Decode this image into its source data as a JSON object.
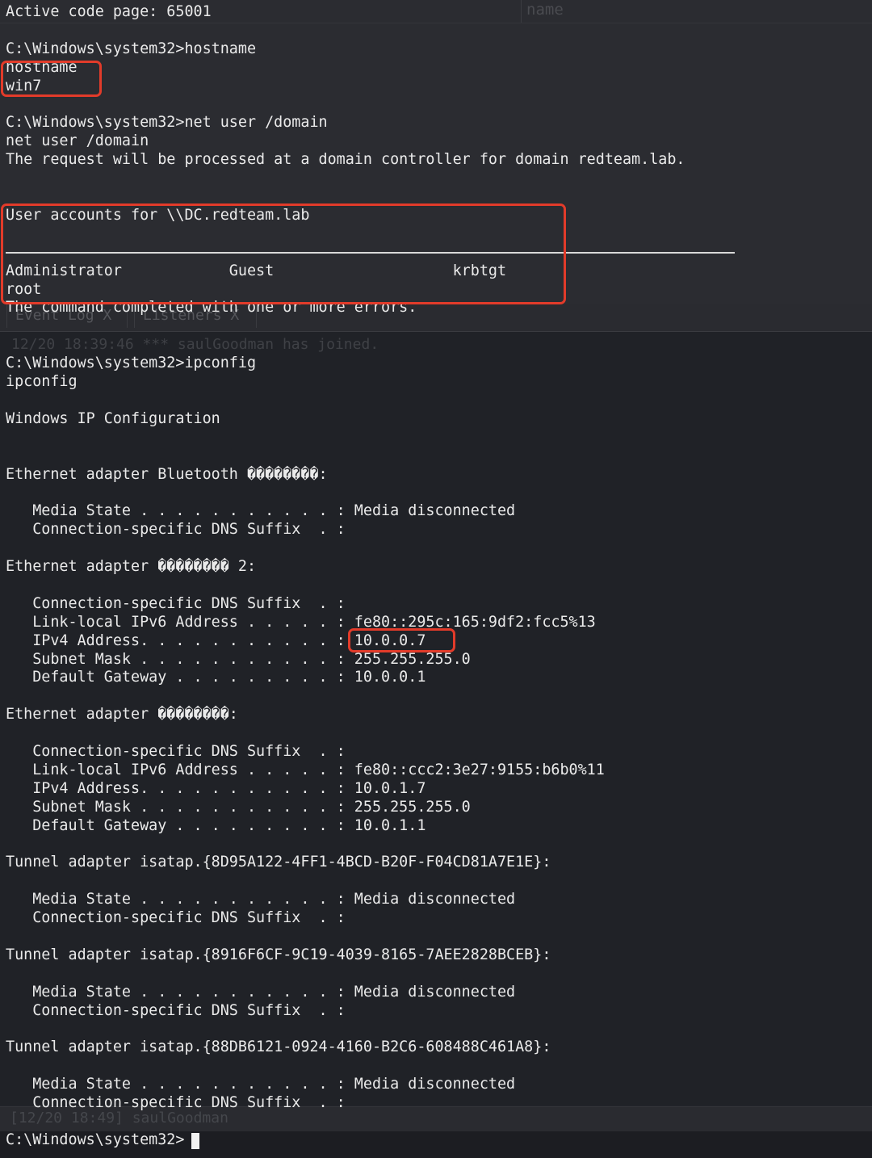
{
  "ghost_ui": {
    "name_header": "name",
    "tab_eventlog": "Event Log  X",
    "tab_listeners": "Listeners  X",
    "event_log_entry": "12/20 18:39:46 *** saulGoodman has joined.",
    "input_prompt": "[12/20 18:49] saulGoodman"
  },
  "terminal": {
    "lines": [
      "Active code page: 65001",
      "",
      "C:\\Windows\\system32>hostname",
      "hostname",
      "win7",
      "",
      "C:\\Windows\\system32>net user /domain",
      "net user /domain",
      "The request will be processed at a domain controller for domain redteam.lab.",
      "",
      "",
      "User accounts for \\\\DC.redteam.lab",
      "",
      "",
      "Administrator            Guest                    krbtgt",
      "root",
      "The command completed with one or more errors.",
      "",
      "",
      "C:\\Windows\\system32>ipconfig",
      "ipconfig",
      "",
      "Windows IP Configuration",
      "",
      "",
      "Ethernet adapter Bluetooth ��������:",
      "",
      "   Media State . . . . . . . . . . . : Media disconnected",
      "   Connection-specific DNS Suffix  . :",
      "",
      "Ethernet adapter �������� 2:",
      "",
      "   Connection-specific DNS Suffix  . :",
      "   Link-local IPv6 Address . . . . . : fe80::295c:165:9df2:fcc5%13",
      "   IPv4 Address. . . . . . . . . . . : 10.0.0.7",
      "   Subnet Mask . . . . . . . . . . . : 255.255.255.0",
      "   Default Gateway . . . . . . . . . : 10.0.0.1",
      "",
      "Ethernet adapter ��������:",
      "",
      "   Connection-specific DNS Suffix  . :",
      "   Link-local IPv6 Address . . . . . : fe80::ccc2:3e27:9155:b6b0%11",
      "   IPv4 Address. . . . . . . . . . . : 10.0.1.7",
      "   Subnet Mask . . . . . . . . . . . : 255.255.255.0",
      "   Default Gateway . . . . . . . . . : 10.0.1.1",
      "",
      "Tunnel adapter isatap.{8D95A122-4FF1-4BCD-B20F-F04CD81A7E1E}:",
      "",
      "   Media State . . . . . . . . . . . : Media disconnected",
      "   Connection-specific DNS Suffix  . :",
      "",
      "Tunnel adapter isatap.{8916F6CF-9C19-4039-8165-7AEE2828BCEB}:",
      "",
      "   Media State . . . . . . . . . . . : Media disconnected",
      "   Connection-specific DNS Suffix  . :",
      "",
      "Tunnel adapter isatap.{88DB6121-0924-4160-B2C6-608488C461A8}:",
      "",
      "   Media State . . . . . . . . . . . : Media disconnected",
      "   Connection-specific DNS Suffix  . :",
      "",
      "C:\\Windows\\system32>"
    ]
  },
  "colors": {
    "background": "#23252b",
    "text": "#eaeaea",
    "highlight_box": "#e23b2a"
  }
}
